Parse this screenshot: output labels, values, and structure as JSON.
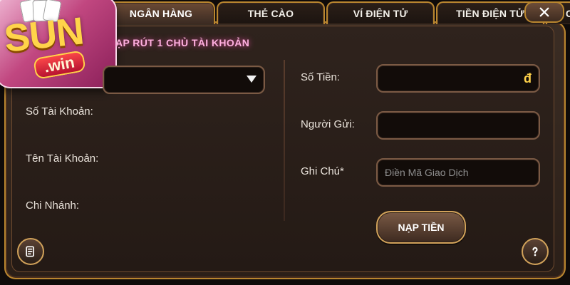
{
  "brand": {
    "logo_text_main": "SUN",
    "logo_text_sub": ".win"
  },
  "tabs": [
    {
      "label": "NGÂN HÀNG",
      "active": true
    },
    {
      "label": "THẺ CÀO",
      "active": false
    },
    {
      "label": "VÍ ĐIỆN TỬ",
      "active": false
    },
    {
      "label": "TIỀN ĐIỆN TỬ",
      "active": false
    },
    {
      "label": "C",
      "active": false
    }
  ],
  "header": {
    "note": "ẠP RÚT 1 CHỦ TÀI KHOẢN"
  },
  "left": {
    "bank_select_value": "",
    "labels": {
      "account_number": "Số Tài Khoản:",
      "account_name": "Tên Tài Khoản:",
      "branch": "Chi Nhánh:"
    }
  },
  "right": {
    "labels": {
      "amount": "Số Tiền:",
      "sender": "Người Gửi:",
      "note": "Ghi Chú*"
    },
    "inputs": {
      "amount_value": "",
      "amount_currency": "đ",
      "sender_value": "",
      "note_value": "",
      "note_placeholder": "Điền Mã Giao Dịch"
    },
    "submit_label": "NẠP TIỀN"
  },
  "colors": {
    "gold": "#b9862f",
    "accent_pink": "#ffb0e0",
    "currency_gold": "#ffd24a"
  },
  "icons": {
    "close": "close-icon",
    "history": "history-icon",
    "help": "help-icon",
    "dropdown": "chevron-down-icon"
  }
}
